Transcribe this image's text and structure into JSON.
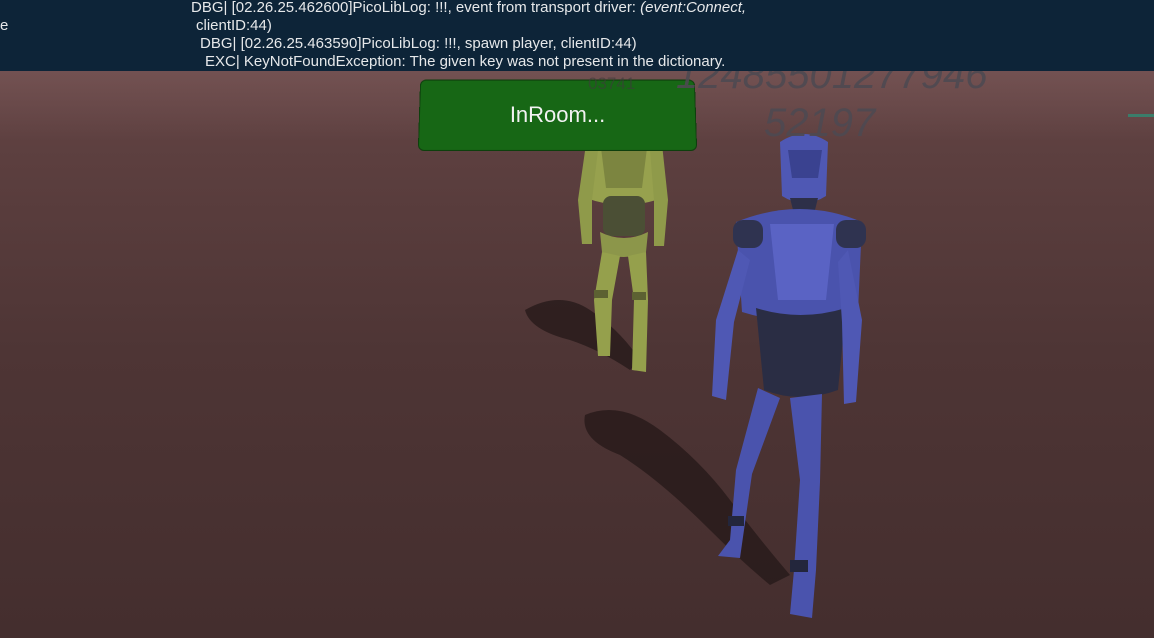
{
  "log": {
    "edge_fragment": "e",
    "line1": "DBG| [02.26.25.462600]PicoLibLog: !!!, event from transport driver: ",
    "line1_italic": "(event:Connect,",
    "line2": "clientID:44)",
    "line3": "DBG| [02.26.25.463590]PicoLibLog: !!!, spawn player, clientID:44)",
    "line4": "EXC| KeyNotFoundException: The given key was not present in the dictionary."
  },
  "room_status": {
    "label": "InRoom..."
  },
  "player_id": {
    "line1": "12485501277946",
    "line2": "52197"
  },
  "remote_id_fragment": "03741",
  "colors": {
    "log_bg": "#0d2438",
    "status_bg": "#176715",
    "ground": "#533838",
    "avatar_remote": "#8f9a4a",
    "avatar_local": "#4a52a8"
  },
  "icons": {
    "marker": "world-axis-marker"
  }
}
